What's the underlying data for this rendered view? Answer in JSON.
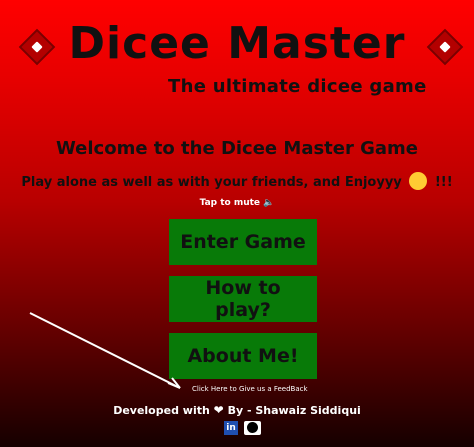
{
  "header": {
    "title": "Dicee Master",
    "subtitle": "The ultimate dicee game"
  },
  "main": {
    "welcome": "Welcome to the Dicee Master Game",
    "tagline_before": "Play alone as well as with your friends, and Enjoyyy",
    "tagline_after": "!!!",
    "mute_text": "Tap to mute",
    "mute_icon": "🔈"
  },
  "buttons": {
    "enter": "Enter Game",
    "howto": "How to play?",
    "about": "About Me!"
  },
  "feedback": {
    "text": "Click Here to Give us a FeedBack"
  },
  "footer": {
    "developed_with": "Developed with",
    "heart": "❤",
    "by": "By - Shawaiz Siddiqui",
    "linkedin_label": "in"
  },
  "icons": {
    "dice": "dice-icon",
    "emoji": "winking-face-icon",
    "linkedin": "linkedin-icon",
    "github": "github-icon"
  },
  "colors": {
    "button": "#087a08",
    "background_top": "#ff0000",
    "background_bottom": "#150000"
  }
}
